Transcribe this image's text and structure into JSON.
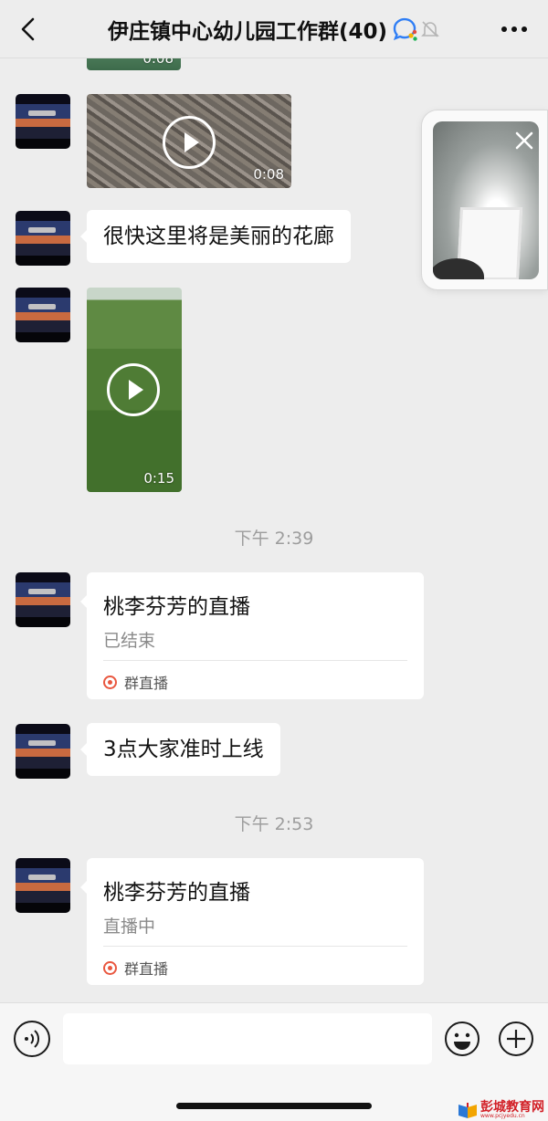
{
  "header": {
    "title": "伊庄镇中心幼儿园工作群(40)",
    "wecom_icon": "wecom-group-icon",
    "mute_icon": "bell-muted-icon",
    "more_icon": "more-dots-icon",
    "back_icon": "chevron-left-icon"
  },
  "messages": {
    "video_top": {
      "duration": "0:08"
    },
    "video_1": {
      "duration": "0:08"
    },
    "text_1": "很快这里将是美丽的花廊",
    "video_2": {
      "duration": "0:15"
    },
    "time_1": "下午 2:39",
    "live_1": {
      "title": "桃李芬芳的直播",
      "status": "已结束",
      "tag": "群直播"
    },
    "text_2": "3点大家准时上线",
    "time_2": "下午 2:53",
    "live_2": {
      "title": "桃李芬芳的直播",
      "status": "直播中",
      "tag": "群直播"
    }
  },
  "input_bar": {
    "voice_icon": "voice-icon",
    "emoji_icon": "emoji-icon",
    "plus_icon": "plus-icon",
    "input_value": ""
  },
  "watermark": {
    "text": "彭城教育网",
    "url": "www.pcjyedu.cn"
  },
  "colors": {
    "background": "#ededed",
    "bubble": "#ffffff",
    "live_red": "#e9573f",
    "timestamp": "#9d9d9d",
    "watermark_red": "#d21f26"
  }
}
